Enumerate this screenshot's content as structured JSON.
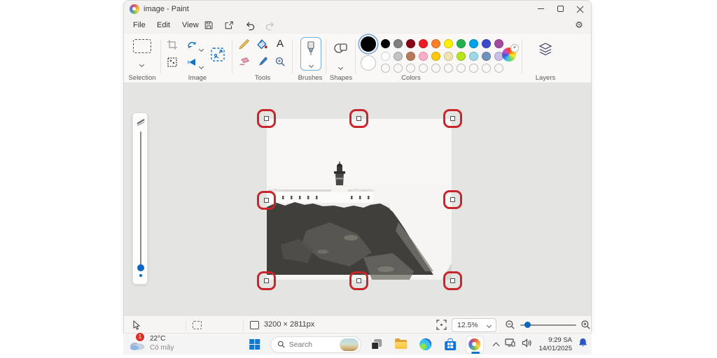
{
  "window": {
    "title": "image - Paint"
  },
  "menu": {
    "file": "File",
    "edit": "Edit",
    "view": "View"
  },
  "toolbar": {
    "selection_label": "Selection",
    "image_label": "Image",
    "tools_label": "Tools",
    "brushes_label": "Brushes",
    "shapes_label": "Shapes",
    "colors_label": "Colors",
    "layers_label": "Layers",
    "text_tool_glyph": "A"
  },
  "palette": {
    "color1": "#000000",
    "color2": "#FFFFFF",
    "row1": [
      "#000000",
      "#7F7F7F",
      "#880015",
      "#ED1C24",
      "#FF7F27",
      "#FFF200",
      "#22B14C",
      "#00A2E8",
      "#3F48CC",
      "#A349A4"
    ],
    "row2": [
      "#FFFFFF",
      "#C3C3C3",
      "#B97A57",
      "#FFAEC9",
      "#FFC90E",
      "#EFE4B0",
      "#B5E61D",
      "#99D9EA",
      "#7092BE",
      "#C8BFE7"
    ],
    "empty_count": 10
  },
  "statusbar": {
    "canvas_size": "3200 × 2811px",
    "zoom": "12.5%"
  },
  "taskbar": {
    "weather_badge": "1",
    "weather_temp": "22°C",
    "weather_condition": "Có mây",
    "search_placeholder": "Search",
    "time": "9:29 SA",
    "date": "14/01/2025"
  },
  "icons": {
    "gear": "⚙"
  }
}
